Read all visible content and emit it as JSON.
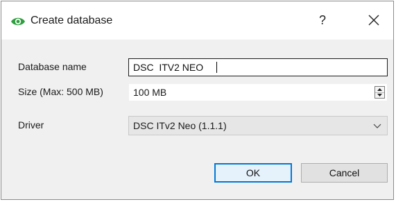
{
  "dialog": {
    "title": "Create database",
    "help_label": "?",
    "icon": "eye-icon",
    "close_icon": "close-icon",
    "accent_color": "#2e9e3e"
  },
  "form": {
    "name_label": "Database name",
    "name_value": "DSC  ITV2 NEO",
    "size_label": "Size (Max: 500 MB)",
    "size_value": "100 MB",
    "driver_label": "Driver",
    "driver_value": "DSC ITv2 Neo (1.1.1)"
  },
  "buttons": {
    "ok_label": "OK",
    "cancel_label": "Cancel"
  }
}
